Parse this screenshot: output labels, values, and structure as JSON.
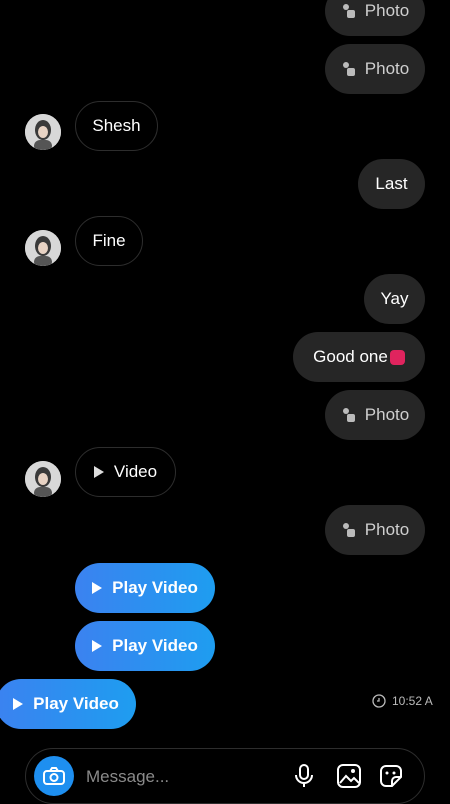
{
  "messages": {
    "photo_1": "Photo",
    "photo_2": "Photo",
    "shesh": "Shesh",
    "last": "Last",
    "fine": "Fine",
    "yay": "Yay",
    "good_one": "Good one",
    "photo_3": "Photo",
    "video": "Video",
    "photo_4": "Photo",
    "play_video_1": "Play Video",
    "play_video_2": "Play Video",
    "play_video_3": "Play Video"
  },
  "timestamp": "10:52 A",
  "composer": {
    "placeholder": "Message..."
  },
  "icons": {
    "camera": "camera-icon",
    "microphone": "microphone-icon",
    "gallery": "gallery-icon",
    "sticker": "sticker-icon"
  },
  "colors": {
    "background": "#000000",
    "sent_bubble": "#262626",
    "accent_blue": "#1e8ff0",
    "emoji_pink": "#e0245e"
  }
}
